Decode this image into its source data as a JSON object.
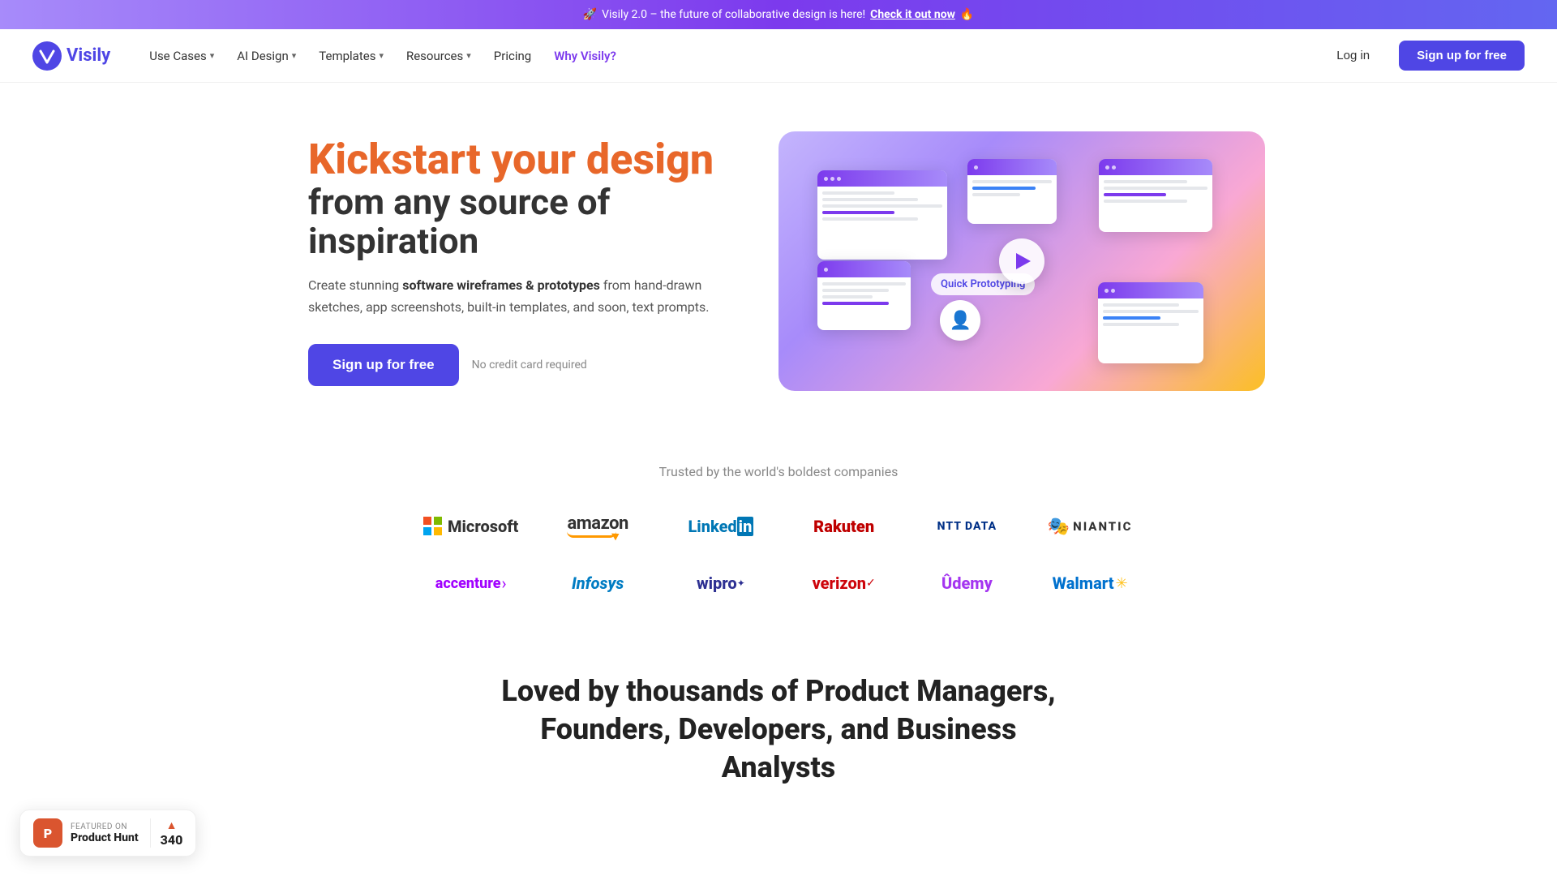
{
  "banner": {
    "emoji_left": "🚀",
    "text": "Visily 2.0 – the future of collaborative design is here!",
    "cta": "Check it out now",
    "emoji_right": "🔥"
  },
  "nav": {
    "logo_text": "Visily",
    "items": [
      {
        "label": "Use Cases",
        "has_dropdown": true
      },
      {
        "label": "AI Design",
        "has_dropdown": true
      },
      {
        "label": "Templates",
        "has_dropdown": true
      },
      {
        "label": "Resources",
        "has_dropdown": true
      },
      {
        "label": "Pricing",
        "has_dropdown": false
      },
      {
        "label": "Why Visily?",
        "has_dropdown": false,
        "active": true
      }
    ],
    "login_label": "Log in",
    "signup_label": "Sign up for free"
  },
  "hero": {
    "title_line1": "Kickstart your design",
    "title_line2": "from any source of inspiration",
    "description_prefix": "Create stunning ",
    "description_bold": "software wireframes & prototypes",
    "description_suffix": " from hand-drawn sketches, app screenshots, built-in templates, and soon, text prompts.",
    "cta_label": "Sign up for free",
    "no_credit_label": "No credit card required",
    "quick_label": "Quick Prototyping"
  },
  "trusted": {
    "title": "Trusted by the world's boldest companies",
    "companies": [
      {
        "name": "Microsoft",
        "key": "microsoft"
      },
      {
        "name": "amazon",
        "key": "amazon"
      },
      {
        "name": "LinkedIn",
        "key": "linkedin"
      },
      {
        "name": "Rakuten",
        "key": "rakuten"
      },
      {
        "name": "NTT DATA",
        "key": "nttdata"
      },
      {
        "name": "NIANTIC",
        "key": "niantic"
      },
      {
        "name": "accenture",
        "key": "accenture"
      },
      {
        "name": "Infosys",
        "key": "infosys"
      },
      {
        "name": "wipro",
        "key": "wipro"
      },
      {
        "name": "verizon",
        "key": "verizon"
      },
      {
        "name": "Udemy",
        "key": "udemy"
      },
      {
        "name": "Walmart",
        "key": "walmart"
      }
    ]
  },
  "bottom_teaser": {
    "title": "Loved by thousands of Product Managers, Founders, Developers, and Business Analysts"
  },
  "product_hunt": {
    "featured_label": "FEATURED ON",
    "name": "Product Hunt",
    "count": "340"
  }
}
